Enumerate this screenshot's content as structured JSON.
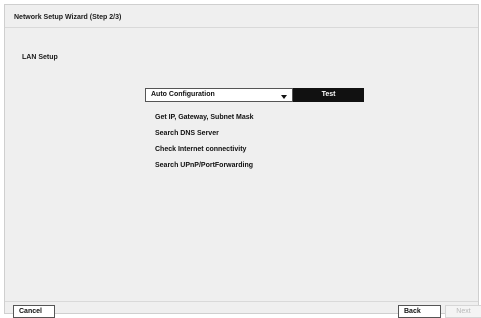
{
  "wizard": {
    "title": "Network Setup Wizard (Step 2/3)",
    "section_label": "LAN Setup"
  },
  "config": {
    "mode_value": "Auto Configuration",
    "test_label": "Test"
  },
  "steps": [
    "Get IP, Gateway, Subnet Mask",
    "Search DNS Server",
    "Check Internet connectivity",
    "Search UPnP/PortForwarding"
  ],
  "footer": {
    "cancel_label": "Cancel",
    "back_label": "Back",
    "next_label": "Next"
  },
  "colors": {
    "window_background": "#efefef",
    "test_button_background": "#111111",
    "disabled_text": "#b9b9b9"
  },
  "icons": {
    "dropdown": "chevron-down-icon"
  }
}
